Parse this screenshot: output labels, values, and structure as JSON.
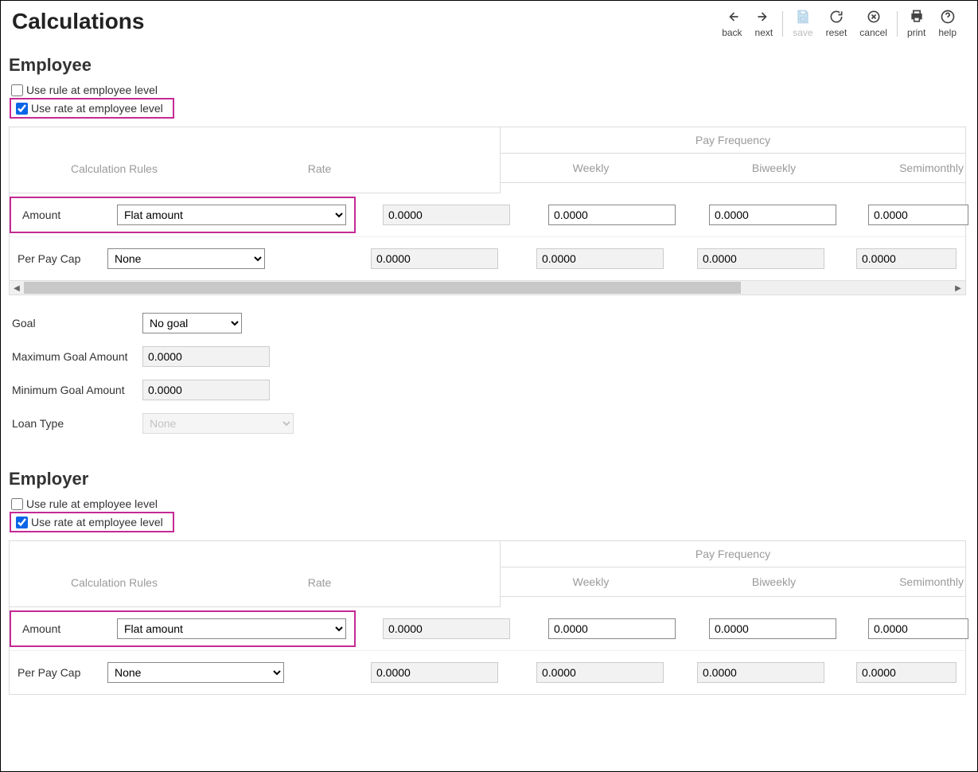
{
  "header": {
    "title": "Calculations",
    "toolbar": {
      "back": "back",
      "next": "next",
      "save": "save",
      "reset": "reset",
      "cancel": "cancel",
      "print": "print",
      "help": "help"
    }
  },
  "sections": {
    "employee": {
      "title": "Employee",
      "use_rule_label": "Use rule at employee level",
      "use_rule_checked": false,
      "use_rate_label": "Use rate at employee level",
      "use_rate_checked": true,
      "grid": {
        "headers": {
          "calc_rules": "Calculation Rules",
          "rate": "Rate",
          "pay_frequency": "Pay Frequency",
          "weekly": "Weekly",
          "biweekly": "Biweekly",
          "semimonthly": "Semimonthly"
        },
        "rows": {
          "amount": {
            "label": "Amount",
            "rule": "Flat amount",
            "rate": "0.0000",
            "weekly": "0.0000",
            "biweekly": "0.0000",
            "semimonthly": "0.0000"
          },
          "per_pay_cap": {
            "label": "Per Pay Cap",
            "rule": "None",
            "rate": "0.0000",
            "weekly": "0.0000",
            "biweekly": "0.0000",
            "semimonthly": "0.0000"
          }
        }
      },
      "form": {
        "goal_label": "Goal",
        "goal_value": "No goal",
        "max_goal_label": "Maximum Goal Amount",
        "max_goal_value": "0.0000",
        "min_goal_label": "Minimum Goal Amount",
        "min_goal_value": "0.0000",
        "loan_type_label": "Loan Type",
        "loan_type_value": "None"
      }
    },
    "employer": {
      "title": "Employer",
      "use_rule_label": "Use rule at employee level",
      "use_rule_checked": false,
      "use_rate_label": "Use rate at employee level",
      "use_rate_checked": true,
      "grid": {
        "headers": {
          "calc_rules": "Calculation Rules",
          "rate": "Rate",
          "pay_frequency": "Pay Frequency",
          "weekly": "Weekly",
          "biweekly": "Biweekly",
          "semimonthly": "Semimonthly"
        },
        "rows": {
          "amount": {
            "label": "Amount",
            "rule": "Flat amount",
            "rate": "0.0000",
            "weekly": "0.0000",
            "biweekly": "0.0000",
            "semimonthly": "0.0000"
          },
          "per_pay_cap": {
            "label": "Per Pay Cap",
            "rule": "None",
            "rate": "0.0000",
            "weekly": "0.0000",
            "biweekly": "0.0000",
            "semimonthly": "0.0000"
          }
        }
      }
    }
  }
}
